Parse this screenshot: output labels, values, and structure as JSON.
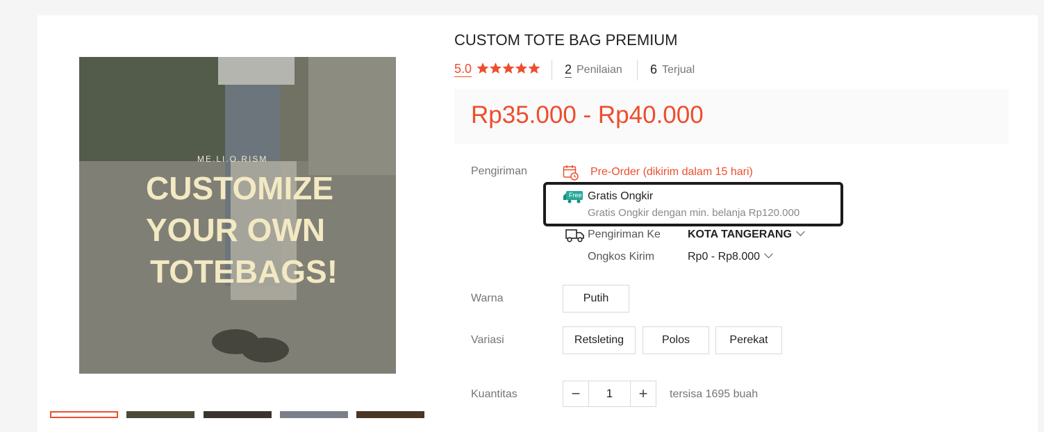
{
  "product": {
    "title": "CUSTOM TOTE BAG PREMIUM",
    "rating": "5.0",
    "reviews_count": "2",
    "reviews_label": "Penilaian",
    "sold_count": "6",
    "sold_label": "Terjual",
    "price": "Rp35.000 - Rp40.000"
  },
  "image": {
    "brand_text": "ME.LI.O.RISM",
    "headline": [
      "CUSTOMIZE",
      "YOUR OWN",
      "TOTEBAGS!"
    ]
  },
  "shipping": {
    "label": "Pengiriman",
    "preorder": "Pre-Order (dikirim dalam 15 hari)",
    "free_badge": "Free",
    "free_title": "Gratis Ongkir",
    "free_desc": "Gratis Ongkir dengan min. belanja Rp120.000",
    "to_label": "Pengiriman Ke",
    "to_value": "KOTA TANGERANG",
    "cost_label": "Ongkos Kirim",
    "cost_value": "Rp0 - Rp8.000"
  },
  "options": {
    "color_label": "Warna",
    "colors": [
      "Putih"
    ],
    "variant_label": "Variasi",
    "variants": [
      "Retsleting",
      "Polos",
      "Perekat"
    ]
  },
  "quantity": {
    "label": "Kuantitas",
    "minus": "−",
    "value": "1",
    "plus": "+",
    "stock": "tersisa 1695 buah"
  },
  "colors": {
    "accent": "#ee4d2d",
    "free": "#26aa99"
  }
}
